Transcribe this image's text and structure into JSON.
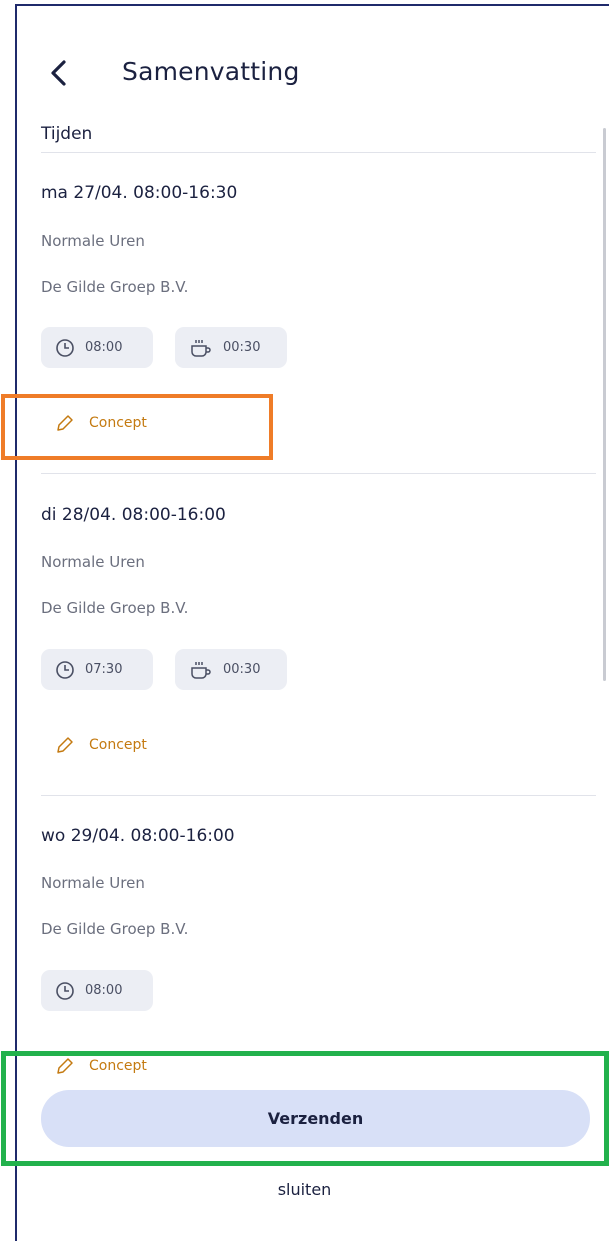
{
  "header": {
    "title": "Samenvatting",
    "back_icon": "chevron-left-icon"
  },
  "section": {
    "title": "Tijden"
  },
  "entries": [
    {
      "date": "ma 27/04. 08:00-16:30",
      "type": "Normale Uren",
      "company": "De Gilde Groep B.V.",
      "worked": "08:00",
      "break": "00:30",
      "status": "Concept"
    },
    {
      "date": "di 28/04. 08:00-16:00",
      "type": "Normale Uren",
      "company": "De Gilde Groep B.V.",
      "worked": "07:30",
      "break": "00:30",
      "status": "Concept"
    },
    {
      "date": "wo 29/04. 08:00-16:00",
      "type": "Normale Uren",
      "company": "De Gilde Groep B.V.",
      "worked": "08:00",
      "status": "Concept"
    }
  ],
  "actions": {
    "send_label": "Verzenden",
    "close_label": "sluiten"
  },
  "colors": {
    "accent_button": "#d8e0f7",
    "status_concept": "#c47a11",
    "highlight_orange": "#ef7c28",
    "highlight_green": "#22b14c"
  }
}
